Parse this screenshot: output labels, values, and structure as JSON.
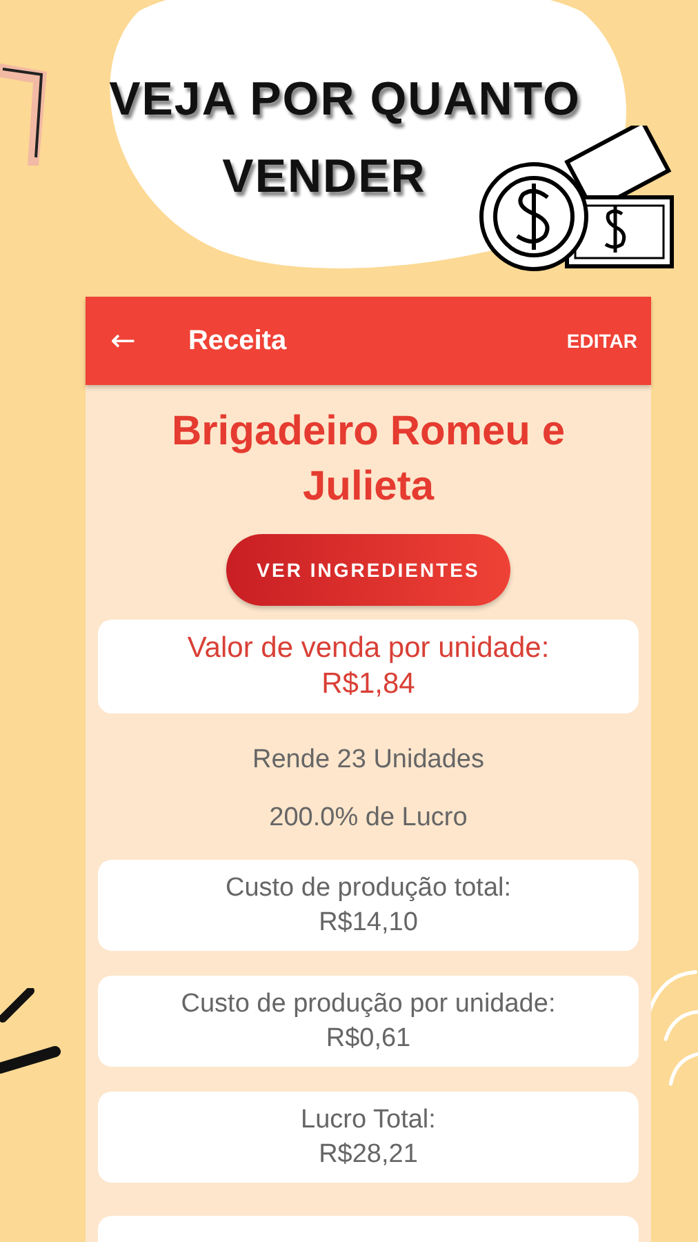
{
  "headline": [
    "VEJA POR QUANTO",
    "VENDER"
  ],
  "app_bar": {
    "back_icon": "←",
    "title": "Receita",
    "action": "EDITAR"
  },
  "recipe_title": "Brigadeiro Romeu e Julieta",
  "ingredients_button": "VER INGREDIENTES",
  "items": [
    {
      "kind": "highlight_card",
      "label": "Valor de venda por unidade:",
      "value": "R$1,84"
    },
    {
      "kind": "text",
      "label": "Rende 23 Unidades"
    },
    {
      "kind": "text",
      "label": "200.0% de Lucro"
    },
    {
      "kind": "card",
      "label": "Custo de produção total:",
      "value": "R$14,10"
    },
    {
      "kind": "card",
      "label": "Custo de produção por unidade:",
      "value": "R$0,61"
    },
    {
      "kind": "card",
      "label": "Lucro Total:",
      "value": "R$28,21"
    }
  ]
}
